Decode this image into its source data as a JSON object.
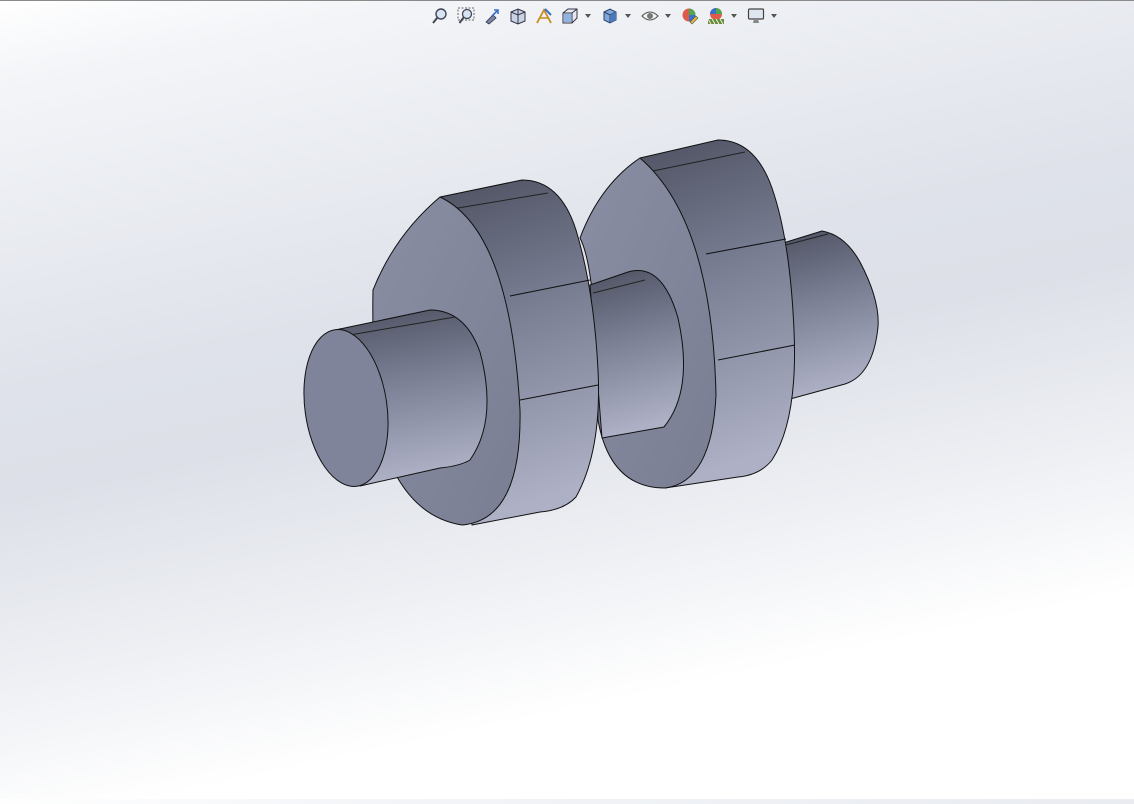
{
  "toolbar": {
    "buttons": [
      {
        "icon": "zoom-to-fit-icon"
      },
      {
        "icon": "zoom-to-area-icon"
      },
      {
        "icon": "previous-view-icon"
      },
      {
        "icon": "section-view-icon"
      },
      {
        "icon": "dynamic-annotation-views-icon"
      },
      {
        "icon": "view-orientation-icon",
        "has_dropdown": true
      },
      {
        "icon": "display-style-icon",
        "has_dropdown": true
      },
      {
        "icon": "hide-show-items-icon",
        "has_dropdown": true
      },
      {
        "icon": "edit-appearance-icon"
      },
      {
        "icon": "apply-scene-icon",
        "has_dropdown": true
      },
      {
        "icon": "view-settings-icon",
        "has_dropdown": true
      }
    ]
  },
  "model": {
    "name": "camshaft-model",
    "body_color": "#868aa0",
    "edge_color": "#1a1a1a"
  },
  "colors": {
    "background_top": "#ffffff",
    "background_band": "#dde0e8",
    "accent": "#2f6fd6"
  }
}
